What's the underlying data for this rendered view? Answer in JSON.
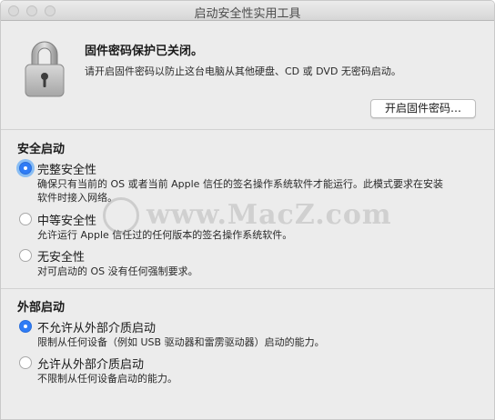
{
  "window": {
    "title": "启动安全性实用工具"
  },
  "firmware": {
    "title": "固件密码保护已关闭。",
    "description": "请开启固件密码以防止这台电脑从其他硬盘、CD 或 DVD 无密码启动。",
    "button_label": "开启固件密码…"
  },
  "secure_boot": {
    "heading": "安全启动",
    "options": [
      {
        "label": "完整安全性",
        "description_line1": "确保只有当前的 OS 或者当前 Apple 信任的签名操作系统软件才能运行。此模式要求在安装",
        "description_line2": "软件时接入网络。",
        "selected": true
      },
      {
        "label": "中等安全性",
        "description_line1": "允许运行 Apple 信任过的任何版本的签名操作系统软件。",
        "selected": false
      },
      {
        "label": "无安全性",
        "description_line1": "对可启动的 OS 没有任何强制要求。",
        "selected": false
      }
    ]
  },
  "external_boot": {
    "heading": "外部启动",
    "options": [
      {
        "label": "不允许从外部介质启动",
        "description_line1": "限制从任何设备（例如 USB 驱动器和雷雳驱动器）启动的能力。",
        "selected": true
      },
      {
        "label": "允许从外部介质启动",
        "description_line1": "不限制从任何设备启动的能力。",
        "selected": false
      }
    ]
  },
  "watermark": {
    "text": "www.MacZ.com"
  },
  "colors": {
    "accent": "#2f7cf6",
    "background": "#ececec"
  }
}
